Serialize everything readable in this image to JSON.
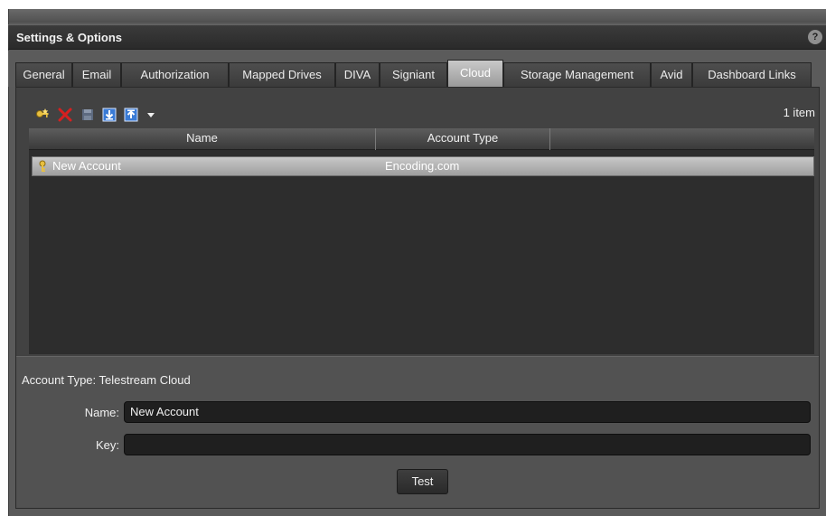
{
  "window": {
    "title": "Settings & Options",
    "help_glyph": "?"
  },
  "tabs": [
    {
      "label": "General"
    },
    {
      "label": "Email"
    },
    {
      "label": "Authorization"
    },
    {
      "label": "Mapped Drives"
    },
    {
      "label": "DIVA"
    },
    {
      "label": "Signiant"
    },
    {
      "label": "Cloud",
      "active": true
    },
    {
      "label": "Storage Management"
    },
    {
      "label": "Avid"
    },
    {
      "label": "Dashboard Links"
    }
  ],
  "toolbar": {
    "buttons": [
      "new-account-icon",
      "delete-icon",
      "save-icon",
      "import-icon",
      "export-icon",
      "dropdown-arrow-icon"
    ],
    "item_count": "1 item"
  },
  "grid": {
    "columns": [
      "Name",
      "Account Type"
    ],
    "rows": [
      {
        "name": "New Account",
        "account_type": "Encoding.com",
        "icon": "key-icon"
      }
    ]
  },
  "details": {
    "account_type": "Account Type: Telestream Cloud",
    "name_label": "Name:",
    "name_value": "New Account",
    "key_label": "Key:",
    "key_value": "",
    "test_label": "Test"
  },
  "colors": {
    "background": "#424242",
    "active_tab": "#b0b0b0",
    "selected_row": "#b4b4b4",
    "delete_red": "#d62020",
    "key_yellow": "#e8c040",
    "save_blue": "#3a7bd5"
  }
}
